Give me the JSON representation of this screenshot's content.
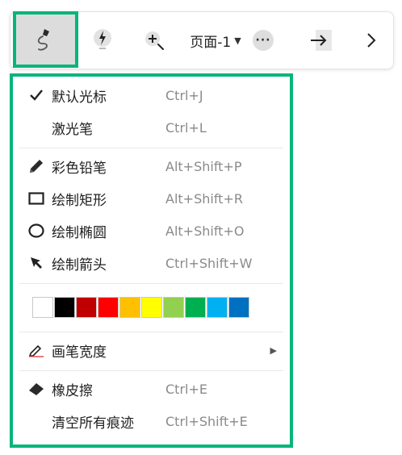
{
  "toolbar": {
    "page_label": "页面-1",
    "more_label": "···"
  },
  "menu": {
    "items": [
      {
        "label": "默认光标",
        "shortcut": "Ctrl+J",
        "icon": "check-icon"
      },
      {
        "label": "激光笔",
        "shortcut": "Ctrl+L",
        "icon": ""
      },
      {
        "label": "彩色铅笔",
        "shortcut": "Alt+Shift+P",
        "icon": "pencil-icon"
      },
      {
        "label": "绘制矩形",
        "shortcut": "Alt+Shift+R",
        "icon": "rectangle-icon"
      },
      {
        "label": "绘制椭圆",
        "shortcut": "Alt+Shift+O",
        "icon": "ellipse-icon"
      },
      {
        "label": "绘制箭头",
        "shortcut": "Ctrl+Shift+W",
        "icon": "arrow-cursor-icon"
      },
      {
        "label": "画笔宽度",
        "shortcut": "",
        "icon": "pen-width-icon"
      },
      {
        "label": "橡皮擦",
        "shortcut": "Ctrl+E",
        "icon": "eraser-icon"
      },
      {
        "label": "清空所有痕迹",
        "shortcut": "Ctrl+Shift+E",
        "icon": ""
      }
    ],
    "colors": [
      "#ffffff",
      "#000000",
      "#c00000",
      "#ff0000",
      "#ffc000",
      "#ffff00",
      "#92d050",
      "#00b050",
      "#00b0f0",
      "#0070c0"
    ]
  },
  "accent": "#06b57a"
}
